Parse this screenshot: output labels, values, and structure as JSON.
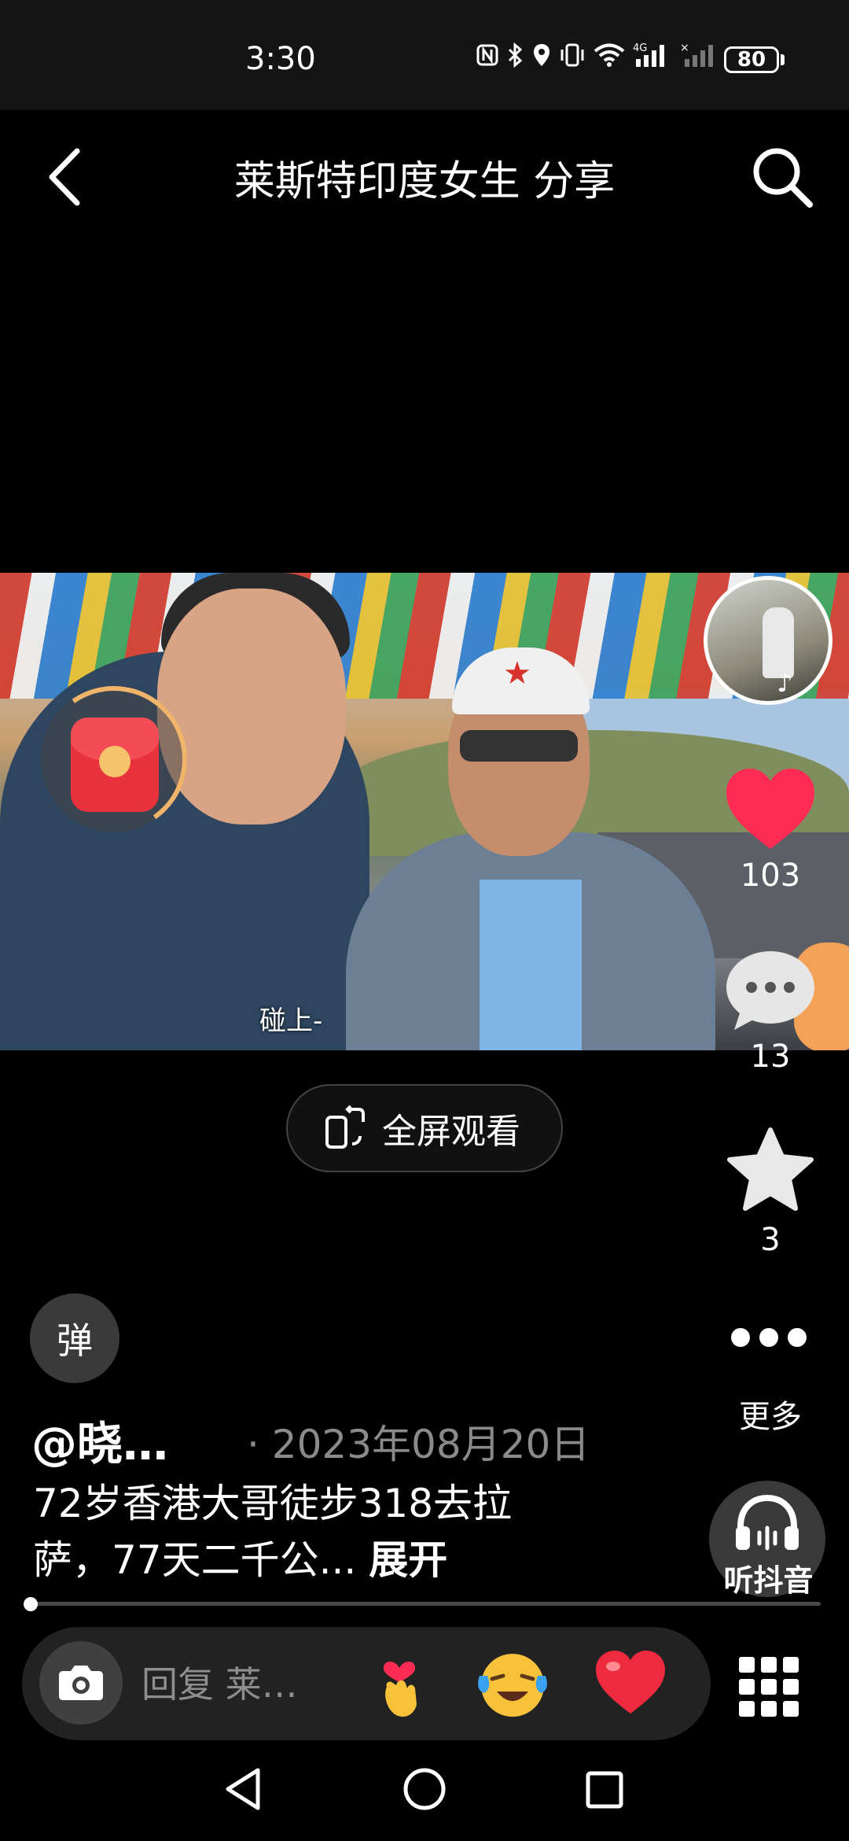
{
  "status_bar": {
    "time": "3:30",
    "icons": [
      "nfc-icon",
      "bluetooth-icon",
      "location-icon",
      "vibrate-icon",
      "wifi-icon",
      "signal-4g-icon",
      "signal-icon"
    ],
    "network_label": "4G",
    "battery": "80"
  },
  "header": {
    "title": "莱斯特印度女生 分享"
  },
  "video": {
    "subtitle": "碰上-"
  },
  "actions": {
    "like_count": "103",
    "comment_count": "13",
    "favorite_count": "3",
    "more_label": "更多",
    "listen_label": "听抖音"
  },
  "fullscreen": {
    "label": "全屏观看"
  },
  "danmaku": {
    "label": "弹"
  },
  "post": {
    "author": "@晓…",
    "date": "· 2023年08月20日",
    "caption": "72岁香港大哥徒步318去拉萨，77天二千公...",
    "expand_label": "展开"
  },
  "progress": {
    "played_fraction": 0.0
  },
  "comment_bar": {
    "placeholder": "回复 莱…",
    "emojis": [
      "heart-hand-emoji",
      "laughing-tears-emoji",
      "red-heart-emoji"
    ]
  },
  "colors": {
    "background": "#000000",
    "like_red": "#fe2c55",
    "envelope_red": "#e8323c"
  }
}
